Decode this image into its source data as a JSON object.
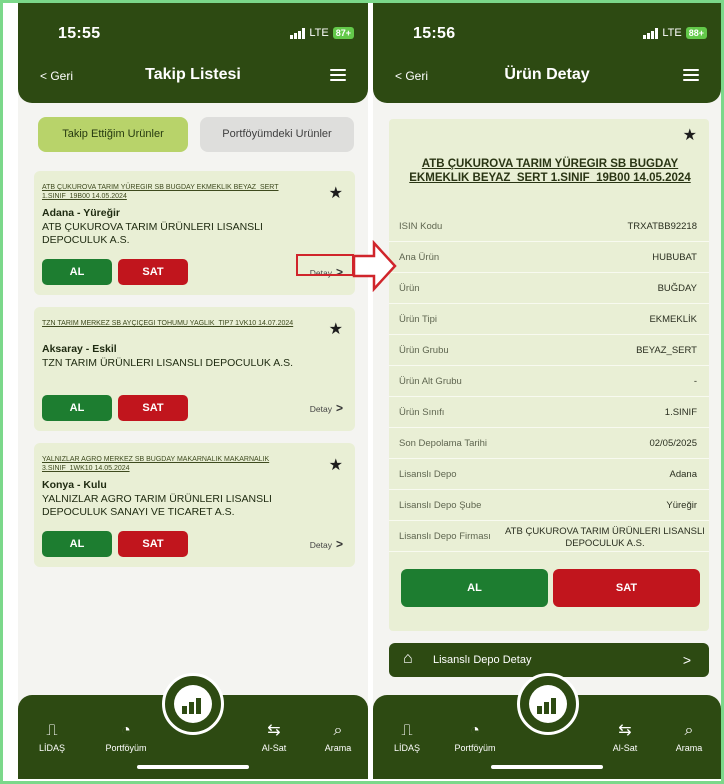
{
  "left": {
    "status": {
      "time": "15:55",
      "network": "LTE",
      "battery": "87+"
    },
    "nav": {
      "back": "< Geri",
      "title": "Takip Listesi"
    },
    "tabs": {
      "active": "Takip Ettiğim Urünler",
      "inactive": "Portföyümdeki Urünler"
    },
    "cards": [
      {
        "name": "ATB ÇUKUROVA TARIM YÜREGIR SB BUGDAY EKMEKLIK BEYAZ_SERT 1.SINIF_19B00 14.05.2024",
        "location": "Adana - Yüreğir",
        "firm": "ATB ÇUKUROVA TARIM ÜRÜNLERI LISANSLI DEPOCULUK A.S.",
        "al": "AL",
        "sat": "SAT",
        "detay": "Detay"
      },
      {
        "name": "TZN TARIM MERKEZ SB AYÇIÇEGI TOHUMU YAGLIK_TIP7 1VK10 14.07.2024",
        "location": "Aksaray - Eskil",
        "firm": "TZN TARIM ÜRÜNLERI LISANSLI DEPOCULUK A.S.",
        "al": "AL",
        "sat": "SAT",
        "detay": "Detay"
      },
      {
        "name": "YALNIZLAR AGRO MERKEZ SB BUGDAY MAKARNALIK MAKARNALIK 3.SINIF_1WK10 14.05.2024",
        "location": "Konya - Kulu",
        "firm": "YALNIZLAR AGRO TARIM ÜRÜNLERI LISANSLI DEPOCULUK SANAYI VE TICARET A.S.",
        "al": "AL",
        "sat": "SAT",
        "detay": "Detay"
      }
    ],
    "bottom_nav": {
      "lidas": "LİDAŞ",
      "portfoy": "Portföyüm",
      "alsat": "Al-Sat",
      "arama": "Arama"
    }
  },
  "right": {
    "status": {
      "time": "15:56",
      "network": "LTE",
      "battery": "88+"
    },
    "nav": {
      "back": "< Geri",
      "title": "Ürün Detay"
    },
    "product_name": "ATB ÇUKUROVA TARIM YÜREGIR SB BUGDAY EKMEKLIK BEYAZ_SERT 1.SINIF_19B00 14.05.2024",
    "details": [
      {
        "key": "ISIN Kodu",
        "value": "TRXATBB92218"
      },
      {
        "key": "Ana Ürün",
        "value": "HUBUBAT"
      },
      {
        "key": "Ürün",
        "value": "BUĞDAY"
      },
      {
        "key": "Ürün Tipi",
        "value": "EKMEKLİK"
      },
      {
        "key": "Ürün Grubu",
        "value": "BEYAZ_SERT"
      },
      {
        "key": "Ürün Alt Grubu",
        "value": "-"
      },
      {
        "key": "Ürün Sınıfı",
        "value": "1.SINIF"
      },
      {
        "key": "Son Depolama Tarihi",
        "value": "02/05/2025"
      },
      {
        "key": "Lisanslı Depo",
        "value": "Adana"
      },
      {
        "key": "Lisanslı Depo Şube",
        "value": "Yüreğir"
      },
      {
        "key": "Lisanslı Depo Firması",
        "value": "ATB ÇUKUROVA TARIM ÜRÜNLERI LISANSLI DEPOCULUK A.S."
      }
    ],
    "al": "AL",
    "sat": "SAT",
    "depo_detay": "Lisanslı Depo Detay",
    "bottom_nav": {
      "lidas": "LİDAŞ",
      "portfoy": "Portföyüm",
      "alsat": "Al-Sat",
      "arama": "Arama"
    }
  },
  "colors": {
    "primary": "#2d4a12",
    "accent": "#b8d36a",
    "card": "#e9efd5",
    "buy": "#1d7d30",
    "sell": "#c1151d",
    "highlight": "#d0252b"
  },
  "icons": [
    "star-icon",
    "menu-icon",
    "chevron-right-icon",
    "lidas-icon",
    "portfolio-icon",
    "swap-icon",
    "search-icon",
    "warehouse-icon",
    "chart-logo-icon"
  ]
}
